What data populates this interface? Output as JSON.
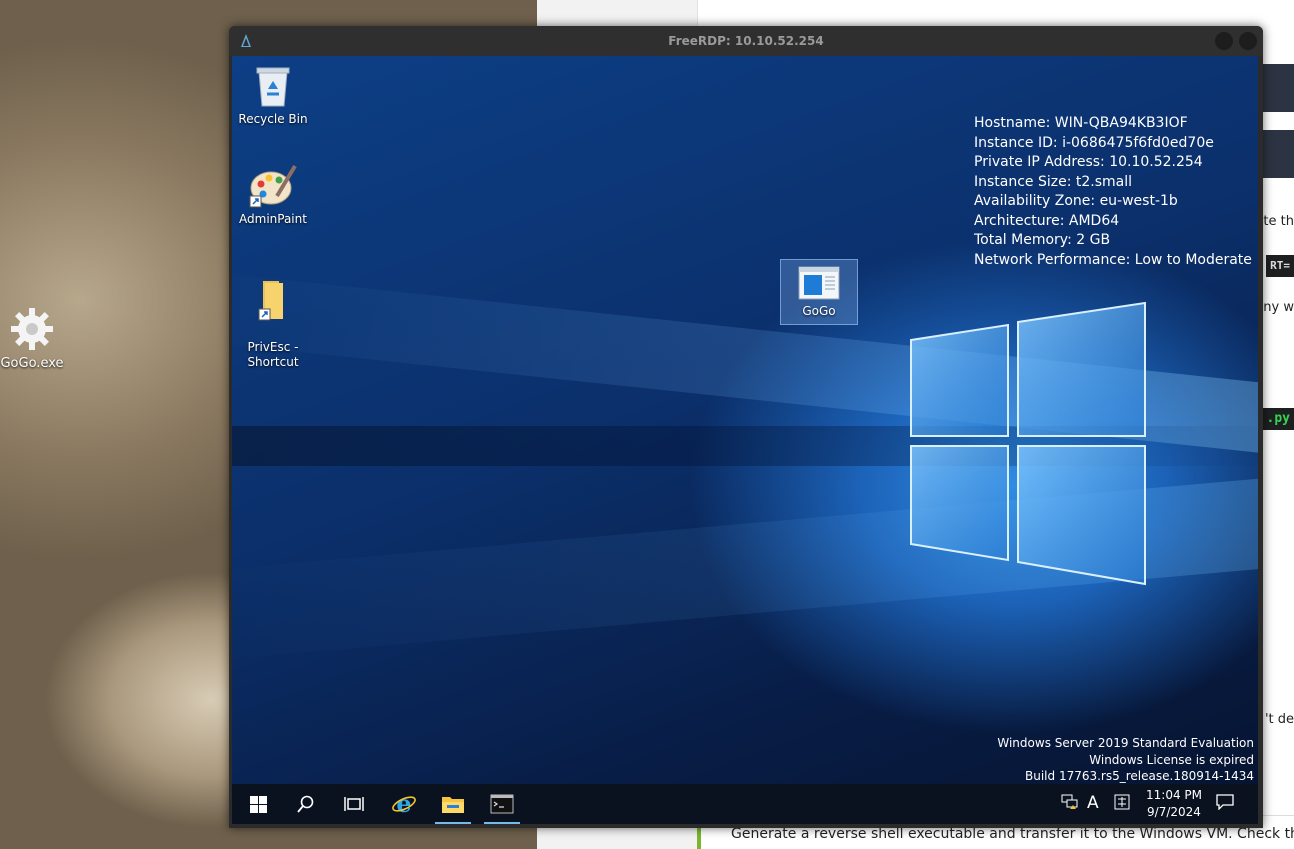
{
  "host": {
    "desktop_icon_label": "GoGo.exe",
    "page_fragments": {
      "text1": "te th",
      "code1": "RT=",
      "text2": "any w",
      "code2": ".py",
      "text3": "'t de",
      "bottom": "Generate a reverse shell executable and transfer it to the Windows VM. Check that it w"
    }
  },
  "rdp_window": {
    "title": "FreeRDP: 10.10.52.254"
  },
  "remote_desktop": {
    "icons": [
      {
        "label": "Recycle Bin"
      },
      {
        "label": "AdminPaint"
      },
      {
        "label": "PrivEsc -\nShortcut"
      },
      {
        "label": "GoGo"
      }
    ],
    "bginfo": [
      "Hostname: WIN-QBA94KB3IOF",
      "Instance ID: i-0686475f6fd0ed70e",
      "Private IP Address: 10.10.52.254",
      "Instance Size: t2.small",
      "Availability Zone: eu-west-1b",
      "Architecture: AMD64",
      "Total Memory: 2 GB",
      "Network Performance: Low to Moderate"
    ],
    "watermark": [
      "Windows Server 2019 Standard Evaluation",
      "Windows License is expired",
      "Build 17763.rs5_release.180914-1434"
    ]
  },
  "taskbar": {
    "time": "11:04 PM",
    "date": "9/7/2024",
    "ime_indicator": "A",
    "icons": [
      "windows-start-icon",
      "search-icon",
      "task-view-icon",
      "internet-explorer-icon",
      "file-explorer-icon",
      "command-prompt-icon"
    ],
    "accent": "#76b9ed"
  }
}
